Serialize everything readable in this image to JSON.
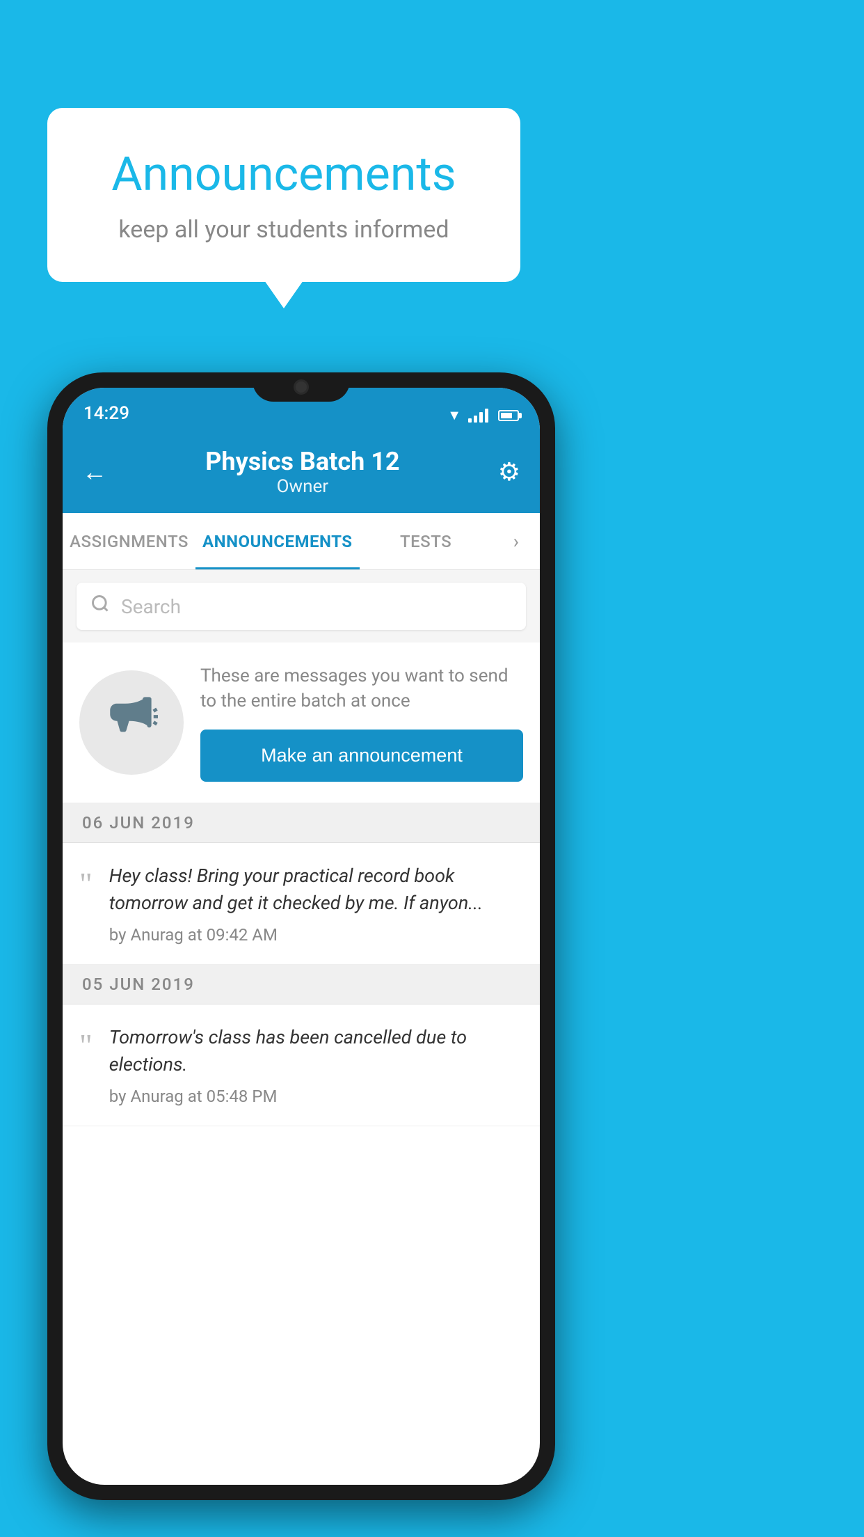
{
  "background_color": "#1ab8e8",
  "speech_bubble": {
    "title": "Announcements",
    "subtitle": "keep all your students informed"
  },
  "phone": {
    "status_bar": {
      "time": "14:29"
    },
    "header": {
      "title": "Physics Batch 12",
      "subtitle": "Owner",
      "back_label": "←",
      "gear_label": "⚙"
    },
    "tabs": [
      {
        "label": "ASSIGNMENTS",
        "active": false
      },
      {
        "label": "ANNOUNCEMENTS",
        "active": true
      },
      {
        "label": "TESTS",
        "active": false
      }
    ],
    "search": {
      "placeholder": "Search"
    },
    "announcement_prompt": {
      "description": "These are messages you want to send to the entire batch at once",
      "button_label": "Make an announcement"
    },
    "announcements": [
      {
        "date": "06  JUN  2019",
        "items": [
          {
            "text": "Hey class! Bring your practical record book tomorrow and get it checked by me. If anyon...",
            "meta": "by Anurag at 09:42 AM"
          }
        ]
      },
      {
        "date": "05  JUN  2019",
        "items": [
          {
            "text": "Tomorrow's class has been cancelled due to elections.",
            "meta": "by Anurag at 05:48 PM"
          }
        ]
      }
    ]
  }
}
